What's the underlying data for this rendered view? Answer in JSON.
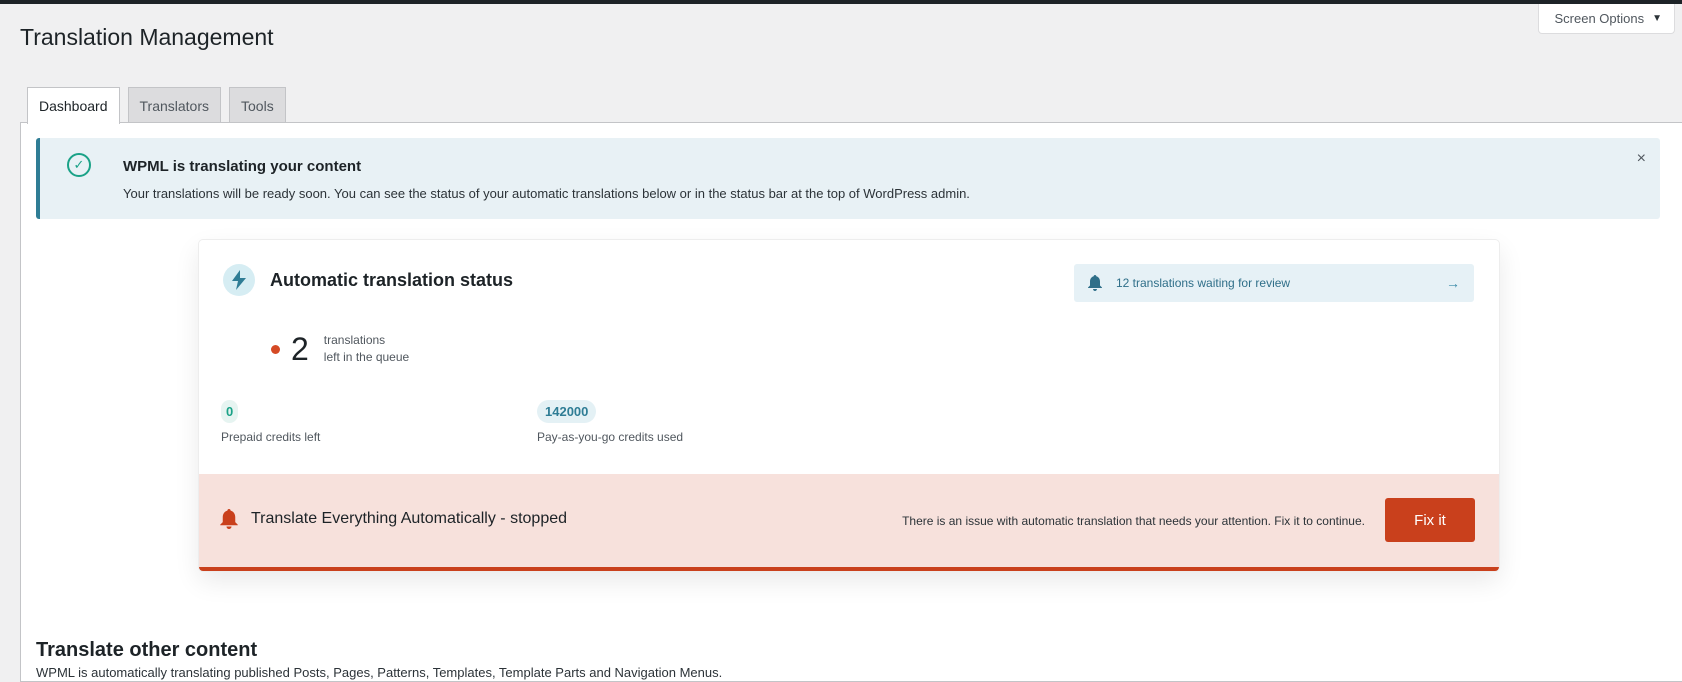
{
  "screen_options": {
    "label": "Screen Options"
  },
  "page": {
    "title": "Translation Management"
  },
  "tabs": [
    {
      "label": "Dashboard",
      "active": true
    },
    {
      "label": "Translators",
      "active": false
    },
    {
      "label": "Tools",
      "active": false
    }
  ],
  "notice": {
    "title": "WPML is translating your content",
    "body": "Your translations will be ready soon. You can see the status of your automatic translations below or in the status bar at the top of WordPress admin.",
    "close": "×"
  },
  "status_card": {
    "title": "Automatic translation status",
    "review_label": "12 translations waiting for review",
    "review_arrow": "→",
    "queue_count": "2",
    "queue_line1": "translations",
    "queue_line2": "left in the queue",
    "prepaid_value": "0",
    "prepaid_label": "Prepaid credits left",
    "payg_value": "142000",
    "payg_label": "Pay-as-you-go credits used"
  },
  "alert": {
    "title": "Translate Everything Automatically - stopped",
    "message": "There is an issue with automatic translation that needs your attention. Fix it to continue.",
    "button": "Fix it"
  },
  "other_content": {
    "title": "Translate other content",
    "description": "WPML is automatically translating published Posts, Pages, Patterns, Templates, Template Parts and Navigation Menus."
  },
  "colors": {
    "accent": "#2f7d95",
    "success": "#1aa287",
    "danger": "#c9401c",
    "alert_bg": "#f7e1dc",
    "notice_bg": "#e8f1f5"
  },
  "icons": {
    "check": "check-circle-icon",
    "bolt": "lightning-bolt-icon",
    "bell": "bell-icon",
    "arrow": "arrow-right-icon",
    "close": "close-icon",
    "caret": "caret-down-icon"
  }
}
